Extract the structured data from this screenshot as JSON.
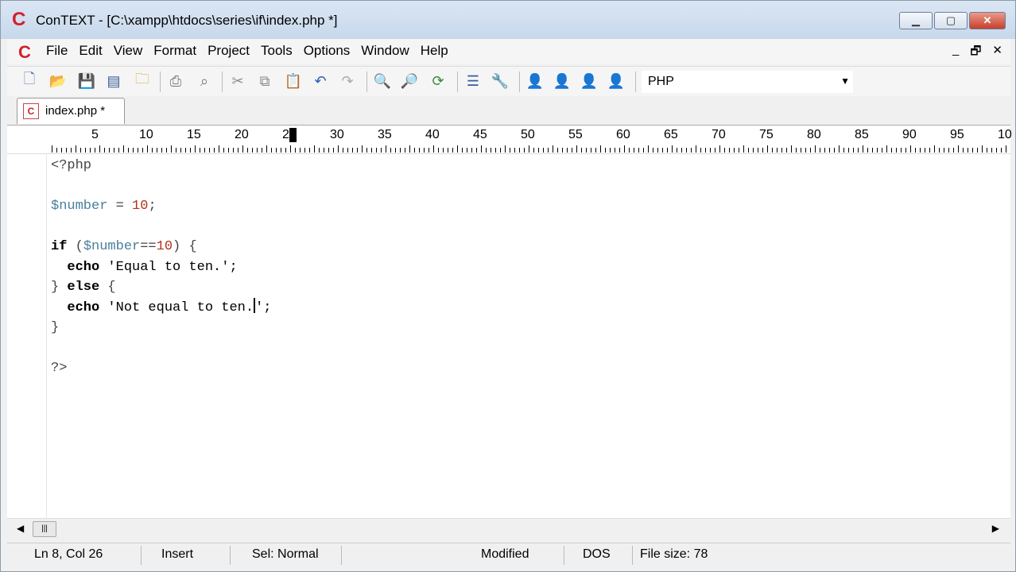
{
  "window": {
    "title": "ConTEXT - [C:\\xampp\\htdocs\\series\\if\\index.php *]",
    "logo": "C",
    "controls": [
      "minimize-icon",
      "maximize-icon",
      "close-icon"
    ]
  },
  "menu": {
    "items": [
      {
        "label": "File"
      },
      {
        "label": "Edit"
      },
      {
        "label": "View"
      },
      {
        "label": "Format"
      },
      {
        "label": "Project"
      },
      {
        "label": "Tools"
      },
      {
        "label": "Options"
      },
      {
        "label": "Window"
      },
      {
        "label": "Help"
      }
    ],
    "mdi": [
      "_",
      "🗗",
      "✕"
    ]
  },
  "toolbar": {
    "icons": [
      "new-file-icon",
      "open-folder-icon",
      "save-icon",
      "save-all-icon",
      "open-project-icon",
      "print-icon",
      "print-preview-icon",
      "cut-icon",
      "copy-icon",
      "paste-icon",
      "undo-icon",
      "redo-icon",
      "find-icon",
      "find-next-icon",
      "replace-icon",
      "format-icon",
      "tools-icon",
      "user-exec-1-icon",
      "user-exec-2-icon",
      "user-exec-3-icon",
      "user-exec-4-icon"
    ],
    "language": "PHP"
  },
  "tab": {
    "label": "index.php *"
  },
  "ruler": {
    "numbers": [
      "5",
      "10",
      "15",
      "20",
      "25",
      "30",
      "35",
      "40",
      "45",
      "50",
      "55",
      "60",
      "65",
      "70",
      "75",
      "80",
      "85",
      "90",
      "95",
      "10"
    ],
    "highlight": "25"
  },
  "editor": {
    "lines": [
      "<?php",
      "",
      "$number = 10;",
      "",
      "if ($number==10) {",
      "  echo 'Equal to ten.';",
      "} else {",
      "  echo 'Not equal to ten.';",
      "}",
      "",
      "?>"
    ]
  },
  "status": {
    "position": "Ln 8, Col 26",
    "mode": "Insert",
    "selection": "Sel: Normal",
    "modified": "Modified",
    "format": "DOS",
    "filesize": "File size: 78"
  }
}
